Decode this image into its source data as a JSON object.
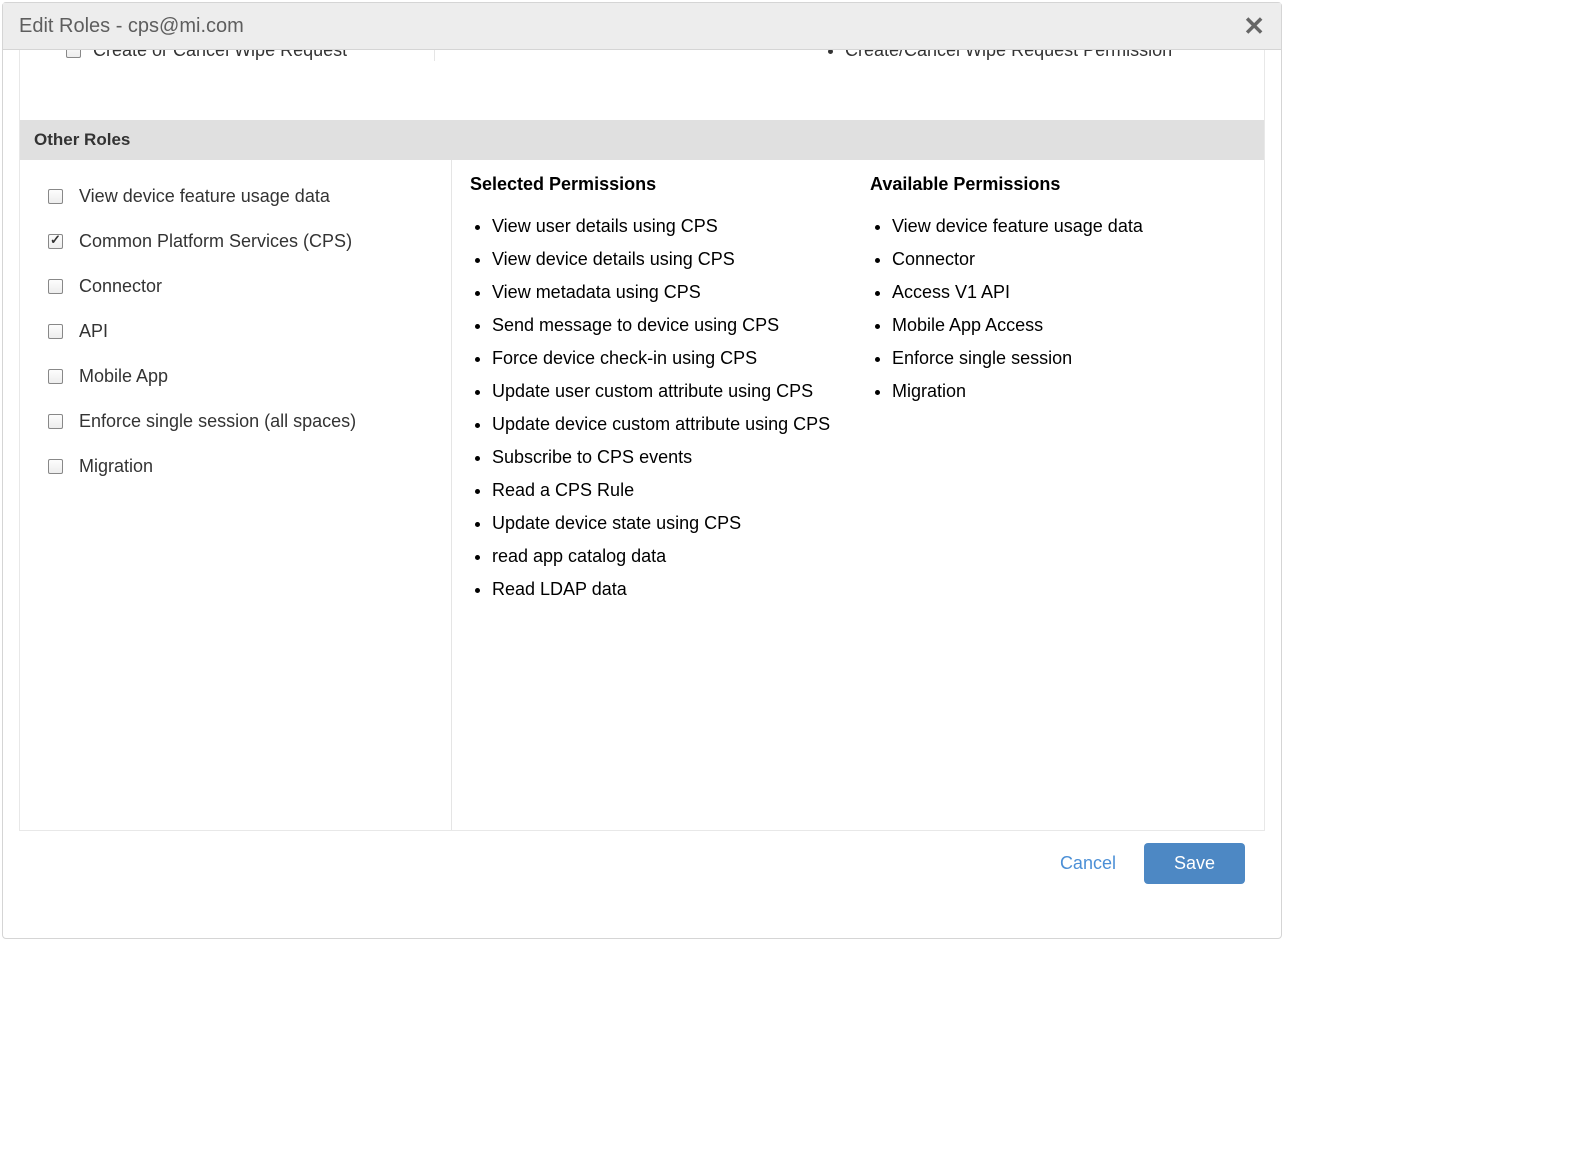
{
  "modal": {
    "title": "Edit Roles - cps@mi.com"
  },
  "topSection": {
    "leftLabel": "Create or Cancel Wipe Request",
    "rightItem": "Create/Cancel Wipe Request Permission"
  },
  "sectionHeader": "Other Roles",
  "roles": [
    {
      "label": "View device feature usage data",
      "checked": false
    },
    {
      "label": "Common Platform Services (CPS)",
      "checked": true
    },
    {
      "label": "Connector",
      "checked": false
    },
    {
      "label": "API",
      "checked": false
    },
    {
      "label": "Mobile App",
      "checked": false
    },
    {
      "label": "Enforce single session (all spaces)",
      "checked": false
    },
    {
      "label": "Migration",
      "checked": false
    }
  ],
  "selectedPermissions": {
    "heading": "Selected Permissions",
    "items": [
      "View user details using CPS",
      "View device details using CPS",
      "View metadata using CPS",
      "Send message to device using CPS",
      "Force device check-in using CPS",
      "Update user custom attribute using CPS",
      "Update device custom attribute using CPS",
      "Subscribe to CPS events",
      "Read a CPS Rule",
      "Update device state using CPS",
      "read app catalog data",
      "Read LDAP data"
    ]
  },
  "availablePermissions": {
    "heading": "Available Permissions",
    "items": [
      "View device feature usage data",
      "Connector",
      "Access V1 API",
      "Mobile App Access",
      "Enforce single session",
      "Migration"
    ]
  },
  "footer": {
    "cancel": "Cancel",
    "save": "Save"
  }
}
